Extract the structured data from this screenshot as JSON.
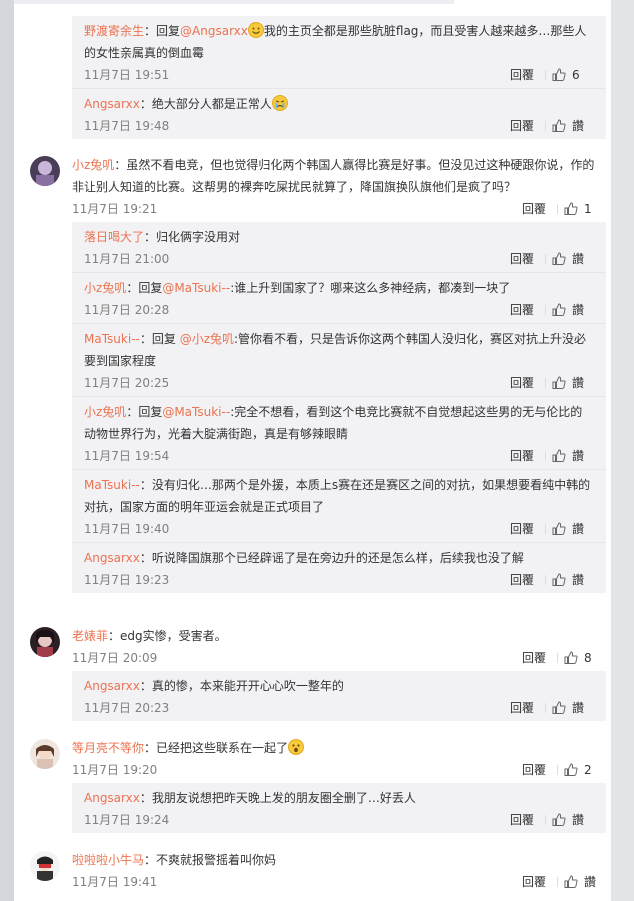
{
  "ui": {
    "reply_label": "回覆",
    "like_placeholder": "讚",
    "colors": {
      "username": "#eb7350",
      "reply_bg": "#f2f2f5",
      "time": "#808080"
    }
  },
  "top_thread": {
    "partial_meta": {
      "like_count": "6"
    },
    "replies": [
      {
        "user": "野渡寄余生",
        "pre_at": "：回复",
        "at": "@Angsarxx",
        "text": "我的主页全都是那些肮脏flag，而且受害人越来越多…那些人的女性亲属真的倒血霉",
        "emoji": "smile-emoji",
        "time": "11月7日 19:51",
        "likes": "6"
      },
      {
        "user": "Angsarxx",
        "text": "：绝大部分人都是正常人",
        "emoji": "cry-emoji",
        "time": "11月7日 19:48",
        "likes": "讚"
      }
    ]
  },
  "comments": [
    {
      "user": "小z兔叽",
      "text": "：虽然不看电竞，但也觉得归化两个韩国人赢得比赛是好事。但没见过这种硬跟你说，作的非让别人知道的比赛。这帮男的裸奔吃屎扰民就算了，降国旗换队旗他们是疯了吗？",
      "time": "11月7日 19:21",
      "likes": "1",
      "replies": [
        {
          "user": "落日喝大了",
          "text": "：归化俩字没用对",
          "time": "11月7日 21:00",
          "likes": "讚"
        },
        {
          "user": "小z兔叽",
          "pre_at": "：回复",
          "at": "@MaTsuki--",
          "text": ":谁上升到国家了？哪来这么多神经病，都凑到一块了",
          "time": "11月7日 20:28",
          "likes": "讚"
        },
        {
          "user": "MaTsuki--",
          "pre_at": "：回复 ",
          "at": "@小z兔叽",
          "text": ":管你看不看，只是告诉你这两个韩国人没归化，赛区对抗上升没必要到国家程度",
          "time": "11月7日 20:25",
          "likes": "讚"
        },
        {
          "user": "小z兔叽",
          "pre_at": "：回复",
          "at": "@MaTsuki--",
          "text": ":完全不想看，看到这个电竞比赛就不自觉想起这些男的无与伦比的动物世界行为，光着大腚满街跑，真是有够辣眼睛",
          "time": "11月7日 19:54",
          "likes": "讚"
        },
        {
          "user": "MaTsuki--",
          "text": "：没有归化…那两个是外援，本质上s赛在还是赛区之间的对抗，如果想要看纯中韩的对抗，国家方面的明年亚运会就是正式项目了",
          "time": "11月7日 19:40",
          "likes": "讚"
        },
        {
          "user": "Angsarxx",
          "text": "：听说降国旗那个已经辟谣了是在旁边升的还是怎么样，后续我也没了解",
          "time": "11月7日 19:23",
          "likes": "讚"
        }
      ]
    },
    {
      "user": "老婊菲",
      "text": "：edg实惨，受害者。",
      "time": "11月7日 20:09",
      "likes": "8",
      "replies": [
        {
          "user": "Angsarxx",
          "text": "：真的惨，本来能开开心心吹一整年的",
          "time": "11月7日 20:23",
          "likes": "讚"
        }
      ]
    },
    {
      "user": "等月亮不等你",
      "text": "：已经把这些联系在一起了",
      "emoji": "surprise-emoji",
      "time": "11月7日 19:20",
      "likes": "2",
      "replies": [
        {
          "user": "Angsarxx",
          "text": "：我朋友说想把昨天晚上发的朋友圈全删了…好丢人",
          "time": "11月7日 19:24",
          "likes": "讚"
        }
      ]
    },
    {
      "user": "啦啦啦小牛马",
      "text": "：不爽就报警摇着叫你妈",
      "time": "11月7日 19:41",
      "likes": "讚",
      "replies": []
    }
  ]
}
